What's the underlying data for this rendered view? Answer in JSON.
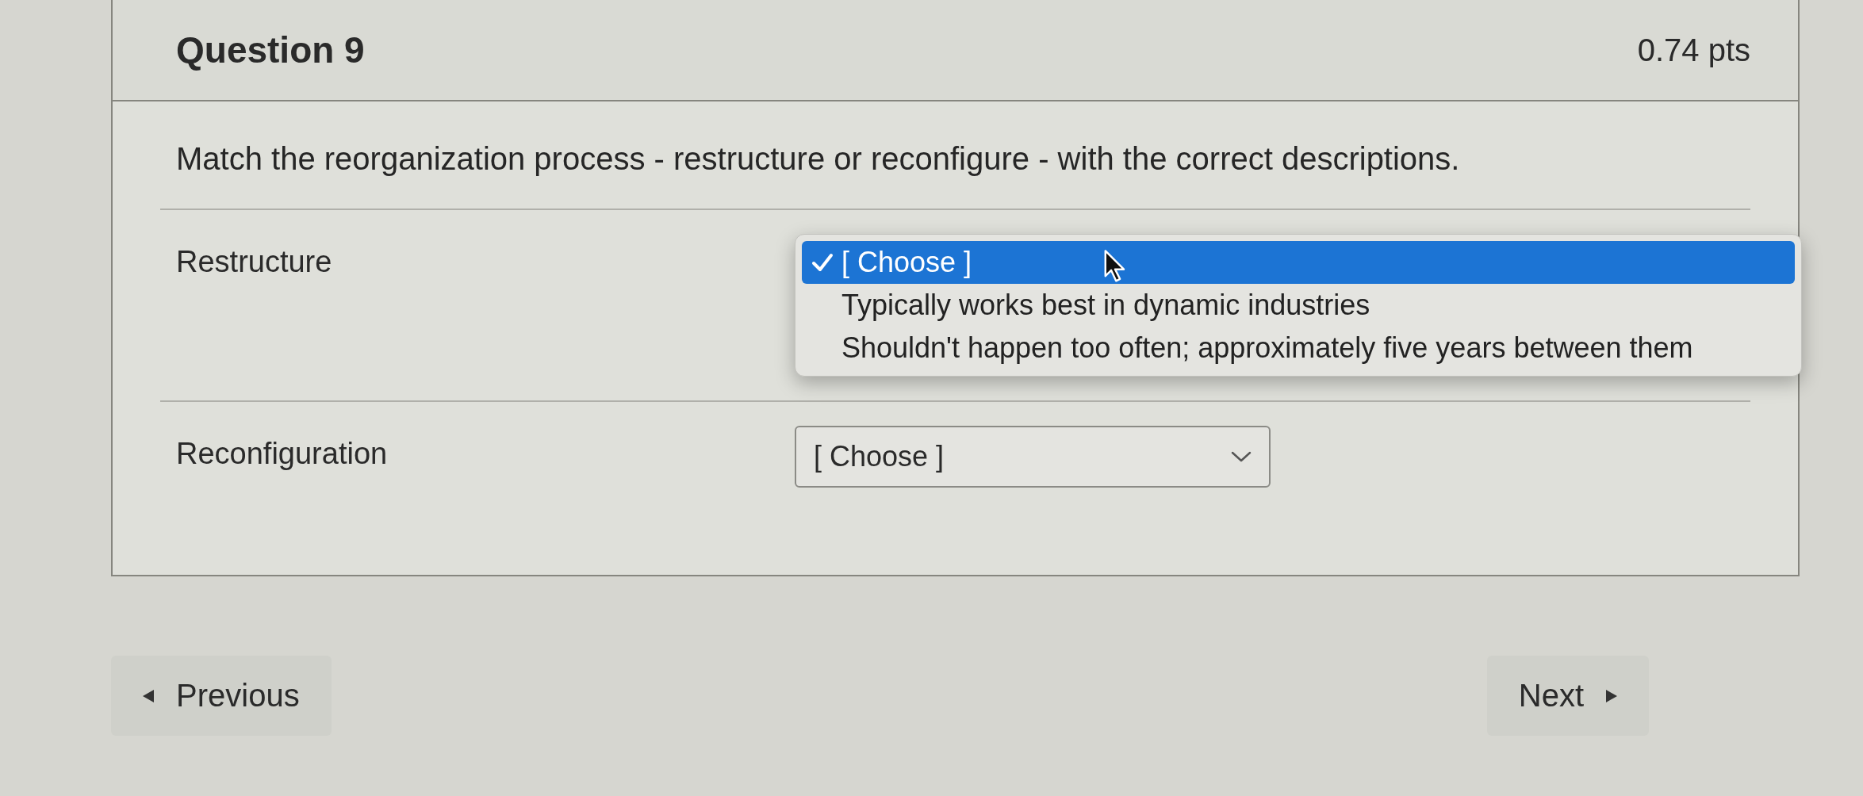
{
  "question": {
    "title": "Question 9",
    "points": "0.74 pts",
    "prompt": "Match the reorganization process - restructure or reconfigure - with the correct descriptions."
  },
  "matches": [
    {
      "label": "Restructure",
      "select": {
        "expanded": true,
        "options": [
          {
            "label": "[ Choose ]",
            "selected": true,
            "highlighted": true
          },
          {
            "label": "Typically works best in dynamic industries",
            "selected": false,
            "highlighted": false
          },
          {
            "label": "Shouldn't happen too often; approximately five years between them",
            "selected": false,
            "highlighted": false
          }
        ]
      }
    },
    {
      "label": "Reconfiguration",
      "select": {
        "expanded": false,
        "value": "[ Choose ]"
      }
    }
  ],
  "navigation": [
    {
      "kind": "previous",
      "label": "Previous"
    },
    {
      "kind": "next",
      "label": "Next"
    }
  ]
}
